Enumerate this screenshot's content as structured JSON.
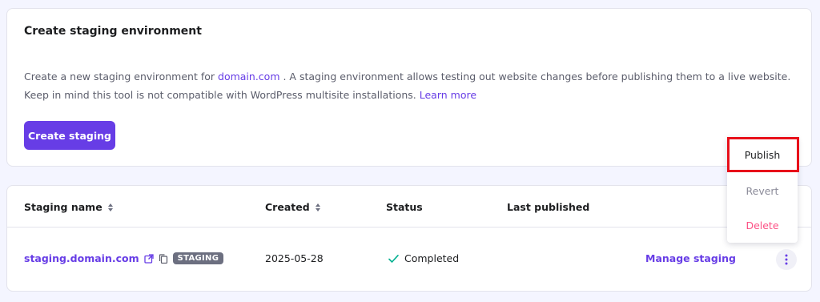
{
  "create_card": {
    "title": "Create staging environment",
    "description_prefix": "Create a new staging environment for ",
    "domain_link": "domain.com",
    "description_body": " . A staging environment allows testing out website changes before publishing them to a live website. Keep in mind this tool is not compatible with WordPress multisite installations. ",
    "learn_more_link": "Learn more",
    "create_button": "Create staging"
  },
  "table": {
    "headers": {
      "staging_name": "Staging name",
      "created": "Created",
      "status": "Status",
      "last_published": "Last published"
    },
    "row": {
      "staging_name": "staging.domain.com",
      "badge": "STAGING",
      "created": "2025-05-28",
      "status": "Completed",
      "last_published": "",
      "manage_link": "Manage staging"
    }
  },
  "context_menu": {
    "items": [
      "Publish",
      "Revert",
      "Delete"
    ],
    "highlighted": "Publish"
  },
  "colors": {
    "accent": "#673de6",
    "danger": "#fc5185",
    "success": "#00b090",
    "highlight_border": "#e8101a"
  },
  "icons": {
    "sort": "sort-icon",
    "external_link": "external-link-icon",
    "copy": "copy-icon",
    "check": "check-icon",
    "kebab": "more-vertical-icon"
  }
}
